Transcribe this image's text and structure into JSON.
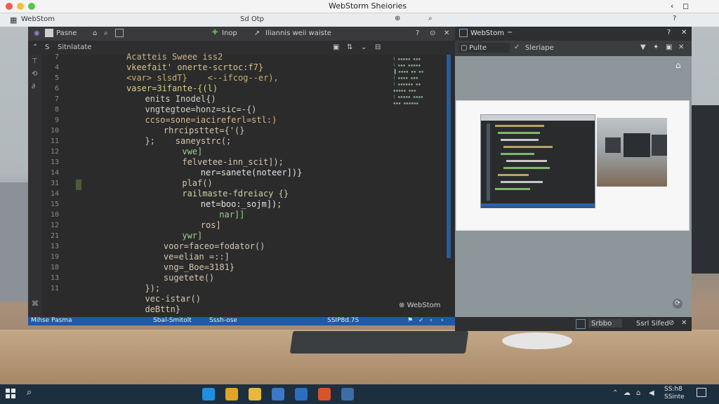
{
  "window": {
    "title": "WebStorm Sheiories",
    "subtitle": "Sd Otp",
    "min": "‹",
    "max": "◻"
  },
  "ide": {
    "tab_file": "Pasne",
    "toolbar": {
      "run_label": "Inop",
      "menu_label": "Iliannis weii waiste",
      "left_label": "Sitnlatate"
    },
    "line_numbers": [
      "7",
      "4",
      "5",
      "6",
      "7",
      "8",
      "9",
      "10",
      "11",
      "12",
      "13",
      "14",
      "31",
      "14",
      "15",
      "10",
      "12",
      "21",
      "13",
      "19",
      "18",
      "13",
      "11"
    ],
    "code_lines": [
      {
        "text": "Acatteis Sweee iss2",
        "color": "#c9b487",
        "indent": 0
      },
      {
        "text": "vkeefait' onerte-scrtoc:f7}",
        "color": "#d6c48a",
        "indent": 0
      },
      {
        "text": "<var> slsdT}    <--ifcog--er),",
        "color": "#c9b06a",
        "indent": 0
      },
      {
        "text": "vaser=3ifante-{(l)",
        "color": "#d7d07e",
        "indent": 0
      },
      {
        "text": "  enits Inodel{)",
        "color": "#cfd3c1",
        "indent": 1
      },
      {
        "text": "  vngtegtoe=honz=sic=-{)",
        "color": "#cfd3c1",
        "indent": 1
      },
      {
        "text": "  ccso=sone=iacireferl=stl:)",
        "color": "#d9b887",
        "indent": 1
      },
      {
        "text": "    rhrcipsttet={'(}",
        "color": "#d7c7ae",
        "indent": 2
      },
      {
        "text": "  };    saneystrc(;",
        "color": "#d7c7ae",
        "indent": 1
      },
      {
        "text": "      vwe]",
        "color": "#9ecf8e",
        "indent": 3
      },
      {
        "text": "      felvetee-inn_scit]);",
        "color": "#d7c7ae",
        "indent": 3
      },
      {
        "text": "        ner=sanete(noteer])}",
        "color": "#e4e4e4",
        "indent": 4
      },
      {
        "text": "      plaf()",
        "color": "#d7c7ae",
        "indent": 3
      },
      {
        "text": "      railmaste-fdreiacy {}",
        "color": "#c9d3a0",
        "indent": 3
      },
      {
        "text": "        net=boo:_sojm]);",
        "color": "#e4e4e4",
        "indent": 4
      },
      {
        "text": "          nar]]",
        "color": "#9ecf8e",
        "indent": 5
      },
      {
        "text": "        ros]",
        "color": "#d7c7ae",
        "indent": 4
      },
      {
        "text": "      ywr]",
        "color": "#9ecf8e",
        "indent": 3
      },
      {
        "text": "    voor=faceo=fodator()",
        "color": "#d7c7ae",
        "indent": 2
      },
      {
        "text": "    ve=elian =::]",
        "color": "#d7c7ae",
        "indent": 2
      },
      {
        "text": "    vng=_Boe=3181}",
        "color": "#d7c7ae",
        "indent": 2
      },
      {
        "text": "    sugetete()",
        "color": "#d7c7ae",
        "indent": 2
      },
      {
        "text": "  });",
        "color": "#d7c7ae",
        "indent": 1
      },
      {
        "text": "  vec-istar()",
        "color": "#d7c7ae",
        "indent": 1
      },
      {
        "text": "  deBttn}",
        "color": "#d7c7ae",
        "indent": 1
      }
    ],
    "brand_badge": "WebStom",
    "status": {
      "left": "Mihse Pasma",
      "mid1": "Sbal-Smitolt",
      "mid2": "Sssh-ose",
      "right": "SSIP8d.7S"
    }
  },
  "right_panel": {
    "title": "WebStom",
    "file_label": "Pulte",
    "preview_label": "Sleriape",
    "bottom": {
      "btn": "Srbbo",
      "label": "Ssrl Sifed"
    }
  },
  "taskbar": {
    "time": "SS:h8",
    "date": "SSinte",
    "apps": [
      {
        "name": "edge-icon",
        "color": "#1f8fe0"
      },
      {
        "name": "chrome-icon",
        "color": "#e0a526"
      },
      {
        "name": "folder-icon",
        "color": "#e8b83a"
      },
      {
        "name": "store-icon",
        "color": "#3b78c9"
      },
      {
        "name": "mail-icon",
        "color": "#2d6ec1"
      },
      {
        "name": "chrome2-icon",
        "color": "#d9532b"
      },
      {
        "name": "webstorm-icon",
        "color": "#3d6da6"
      }
    ]
  }
}
